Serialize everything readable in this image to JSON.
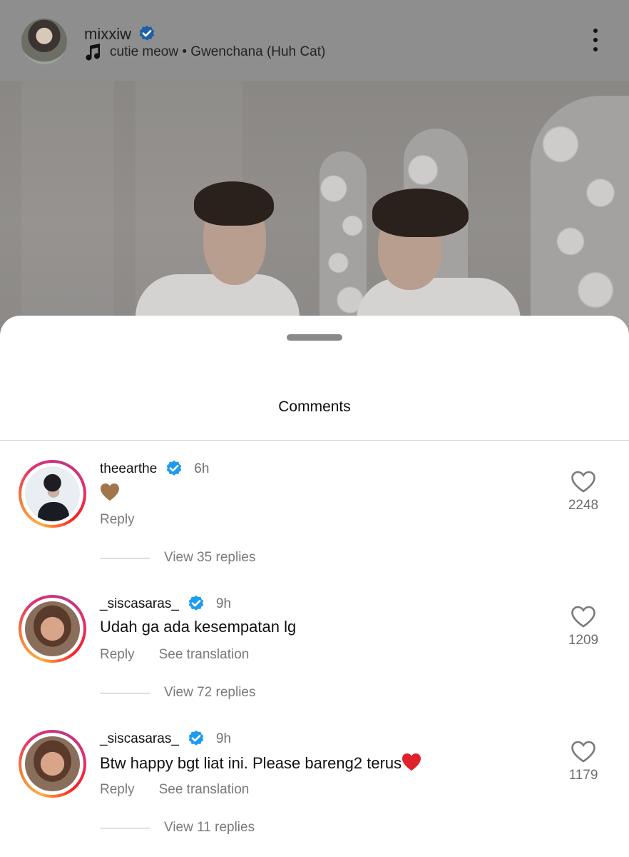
{
  "post": {
    "username": "mixxiw",
    "music": "cutie meow • Gwenchana (Huh Cat)"
  },
  "sheet": {
    "title": "Comments"
  },
  "comments": [
    {
      "username": "theearthe",
      "verified": true,
      "time": "6h",
      "text": "",
      "emoji": "brown-heart",
      "actions": {
        "reply": "Reply",
        "translate": ""
      },
      "view_replies": "View 35 replies",
      "likes": "2248"
    },
    {
      "username": "_siscasaras_",
      "verified": true,
      "time": "9h",
      "text": "Udah ga ada kesempatan lg",
      "actions": {
        "reply": "Reply",
        "translate": "See translation"
      },
      "view_replies": "View 72 replies",
      "likes": "1209"
    },
    {
      "username": "_siscasaras_",
      "verified": true,
      "time": "9h",
      "text": "Btw happy bgt liat ini. Please bareng2 terus",
      "emoji": "red-heart",
      "actions": {
        "reply": "Reply",
        "translate": "See translation"
      },
      "view_replies": "View 11 replies",
      "likes": "1179"
    }
  ],
  "colors": {
    "verified": "#1d9bf0",
    "dim_overlay": "#8e8e8e",
    "muted_text": "#7a7a7a",
    "brown_heart": "#a0764a",
    "red_heart": "#e0202a"
  },
  "icons": [
    "music-note-icon",
    "verified-badge-icon",
    "more-options-icon",
    "heart-outline-icon",
    "brown-heart-emoji",
    "red-heart-emoji"
  ]
}
